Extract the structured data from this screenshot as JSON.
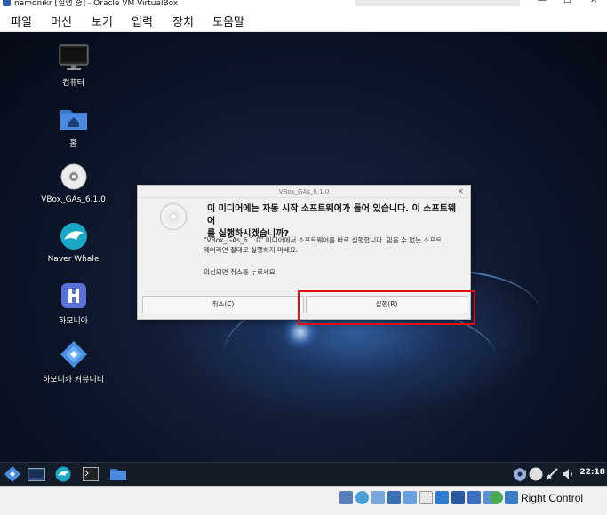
{
  "window": {
    "title": "namonikr [실행 중] - Oracle VM VirtualBox",
    "minimize": "—",
    "maximize": "☐",
    "close": "✕"
  },
  "menu": [
    "파일",
    "머신",
    "보기",
    "입력",
    "장치",
    "도움말"
  ],
  "desktop_icons": [
    {
      "label": "컴퓨터",
      "icon": "computer-icon"
    },
    {
      "label": "홈",
      "icon": "home-folder-icon"
    },
    {
      "label": "VBox_GAs_6.1.0",
      "icon": "cd-drive-icon"
    },
    {
      "label": "Naver Whale",
      "icon": "whale-browser-icon"
    },
    {
      "label": "하모니아",
      "icon": "hamonia-icon"
    },
    {
      "label": "하모니카 커뮤니티",
      "icon": "hamonikr-community-icon"
    }
  ],
  "dialog": {
    "title": "VBox_GAs_6.1.0",
    "close": "×",
    "heading_line1": "이 미디어에는 자동 시작 소프트웨어가 들어 있습니다. 이 소프트웨어",
    "heading_line2": "를 실행하시겠습니까?",
    "body_line1": "\"VBox_GAs_6.1.0\" 미디어에서 소프트웨어를 바로 실행합니다. 믿을 수 없는 소프트",
    "body_line2": "웨어라면 절대로 실행하지 마세요.",
    "note": "의심되면 취소를 누르세요.",
    "cancel_label": "취소(C)",
    "run_label": "실행(R)"
  },
  "taskbar": {
    "clock": "22:18"
  },
  "statusbar": {
    "host_key": "Right Control"
  },
  "colors": {
    "highlight": "#e01010",
    "taskbar": "#141c2a"
  }
}
